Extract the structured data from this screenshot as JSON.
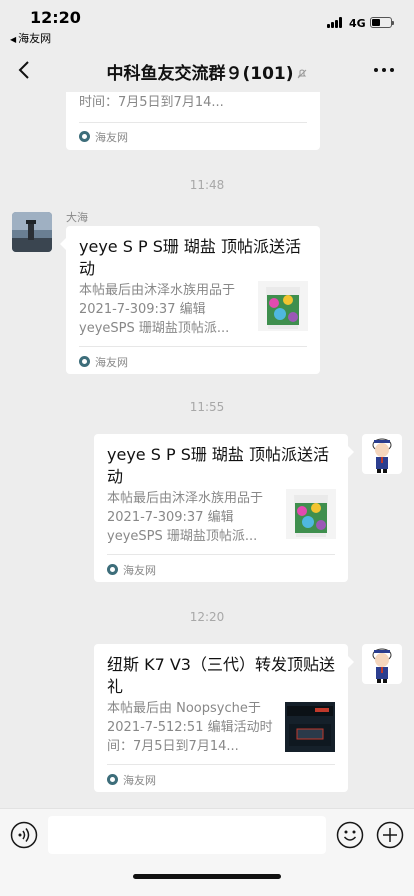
{
  "status_bar": {
    "time": "12:20",
    "back_app": "海友网",
    "network": "4G"
  },
  "nav": {
    "title": "中科鱼友交流群９(101)"
  },
  "messages": [
    {
      "side": "left",
      "desc": "时间：7月5日到7月14...",
      "source": "海友网"
    },
    {
      "timestamp": "11:48"
    },
    {
      "side": "left",
      "sender": "大海",
      "title": "yeye S P S珊 瑚盐 顶帖派送活动",
      "desc": "本帖最后由沐泽水族用品于 2021-7-309:37 编辑 yeyeSPS 珊瑚盐顶帖派...",
      "source": "海友网"
    },
    {
      "timestamp": "11:55"
    },
    {
      "side": "right",
      "title": "yeye S P S珊 瑚盐 顶帖派送活动",
      "desc": "本帖最后由沐泽水族用品于 2021-7-309:37 编辑 yeyeSPS 珊瑚盐顶帖派...",
      "source": "海友网"
    },
    {
      "timestamp": "12:20"
    },
    {
      "side": "right",
      "title": "纽斯 K7 V3（三代）转发顶贴送礼",
      "desc": "本帖最后由 Noopsyche于 2021-7-512:51 编辑活动时间：7月5日到7月14...",
      "source": "海友网"
    }
  ],
  "input": {
    "placeholder": ""
  },
  "icons": [
    "back-chevron-icon",
    "mute-icon",
    "more-icon",
    "voice-icon",
    "emoji-icon",
    "plus-icon",
    "source-logo-icon"
  ],
  "colors": {
    "background": "#ededed",
    "card": "#ffffff",
    "muted_text": "#888888"
  }
}
